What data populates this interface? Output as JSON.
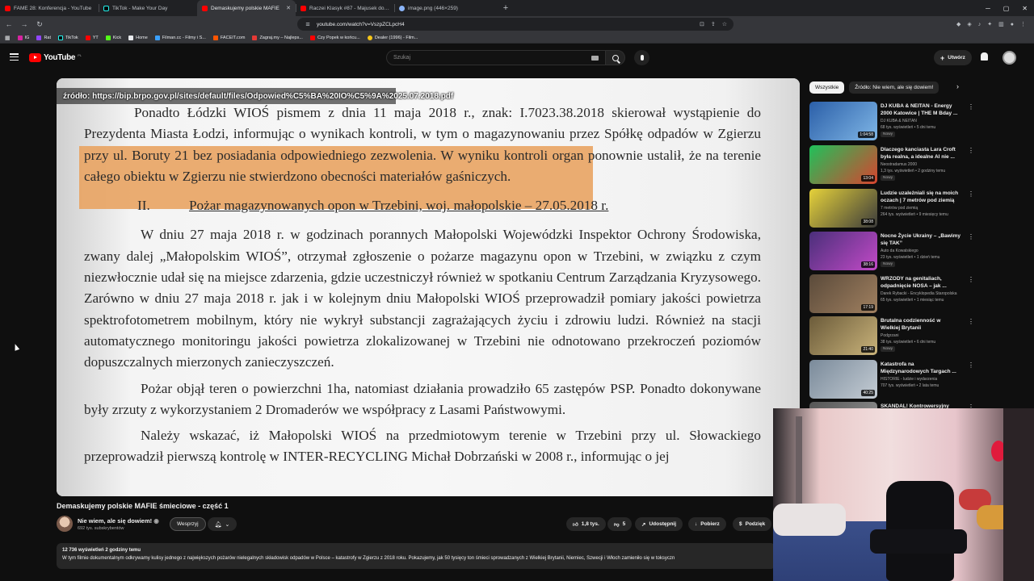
{
  "browser": {
    "tabs": [
      {
        "title": "FAME 28: Konferencja - YouTube",
        "icon": "youtube-favicon",
        "active": false
      },
      {
        "title": "TikTok - Make Your Day",
        "icon": "tiktok-favicon",
        "active": false
      },
      {
        "title": "Demaskujemy polskie MAFIE",
        "icon": "youtube-favicon",
        "active": true
      },
      {
        "title": "Raczei Klasyk #87 - Majusek dostaje",
        "icon": "youtube-favicon",
        "active": false
      },
      {
        "title": "image.png (446×259)",
        "icon": "globe-favicon",
        "active": false
      }
    ],
    "url": "youtube.com/watch?v=VszpZCLpcH4",
    "bookmarks": [
      "IG",
      "Rat",
      "TikTok",
      "YT",
      "Kick",
      "Home",
      "Filman.cc - Filmy i S...",
      "FACEIT.com",
      "Zagraj.my – Najleps...",
      "Czy Popek w końcu...",
      "Dealer (1996) - Film..."
    ]
  },
  "header": {
    "logo_text": "YouTube",
    "country": "PL",
    "search_placeholder": "Szukaj",
    "create_label": "Utwórz"
  },
  "player": {
    "source_label": "źródło: https://bip.brpo.gov.pl/sites/default/files/Odpowied%C5%BA%20IO%C5%9A%2025.07.2018.pdf",
    "paragraph1": "Ponadto Łódzki WIOŚ pismem z dnia 11 maja 2018 r., znak: I.7023.38.2018 skierował wystąpienie do Prezydenta Miasta Łodzi, informując o wynikach kontroli, w tym o magazynowaniu przez Spółkę odpadów w Zgierzu przy ul. Boruty 21 bez posiadania odpowiedniego zezwolenia. W wyniku kontroli organ ponownie ustalił, że na terenie całego obiektu w Zgierzu nie stwierdzono obecności materiałów gaśniczych.",
    "heading_num": "II.",
    "heading_text": "Pożar magazynowanych opon w Trzebini, woj. małopolskie – 27.05.2018 r.",
    "paragraph2": "W dniu 27 maja 2018 r. w godzinach porannych Małopolski Wojewódzki Inspektor Ochrony Środowiska, zwany dalej „Małopolskim WIOŚ”, otrzymał zgłoszenie o pożarze magazynu opon w Trzebini, w związku z czym niezwłocznie udał się na miejsce zdarzenia, gdzie uczestniczył również w spotkaniu Centrum Zarządzania Kryzysowego. Zarówno w dniu 27 maja 2018 r. jak i w kolejnym dniu Małopolski WIOŚ przeprowadził pomiary jakości powietrza spektrofotometrem mobilnym, który nie wykrył substancji zagrażających życiu i zdrowiu ludzi. Również na stacji automatycznego monitoringu jakości powietrza zlokalizowanej w Trzebini nie odnotowano przekroczeń poziomów dopuszczalnych mierzonych zanieczyszczeń.",
    "paragraph3": "Pożar objął teren o powierzchni 1ha, natomiast działania prowadziło 65 zastępów PSP. Ponadto dokonywane były zrzuty z wykorzystaniem 2 Dromaderów we współpracy z Lasami Państwowymi.",
    "paragraph4": "Należy wskazać, iż Małopolski WIOŚ na przedmiotowym terenie w Trzebini przy ul. Słowackiego przeprowadził pierwszą kontrolę w INTER-RECYCLING Michał Dobrzański w 2008 r., informując o jej"
  },
  "video": {
    "title": "Demaskujemy polskie MAFIE śmieciowe - część 1",
    "channel": "Nie wiem, ale się dowiem!",
    "subscribers": "692 tys. subskrybentów",
    "support_label": "Wesprzyj",
    "likes": "1,8 tys.",
    "dislikes": "5",
    "share_label": "Udostępnij",
    "download_label": "Pobierz",
    "thanks_label": "Podzięk",
    "views_time": "12 736 wyświetleń  2 godziny temu",
    "description": "W tym filmie dokumentalnym odkrywamy kulisy jednego z największych pożarów nielegalnych składowisk odpadów w Polsce – katastrofy w Zgierzu z 2018 roku. Pokazujemy, jak 50 tysięcy ton śmieci sprowadzanych z Wielkiej Brytanii, Niemiec, Szwecji i Włoch zamieniło się w toksyczn"
  },
  "sidebar": {
    "chips": [
      "Wszystkie",
      "Źródło: Nie wiem, ale się dowiem!"
    ],
    "recommendations": [
      {
        "title": "DJ KUBA & NEITAN - Energy 2000 Katowice | THE M Bday ...",
        "channel": "DJ KUBA & NEITAN",
        "meta": "68 tys. wyświetleń • 5 dni temu",
        "badge": "Nowy",
        "duration": "1:04:58",
        "color_a": "#2b5fa8",
        "color_b": "#7fb6e6"
      },
      {
        "title": "Dlaczego kanciasta Lara Croft była realna, a idealne AI nie ...",
        "channel": "Neostradamus 2000",
        "meta": "1,3 tys. wyświetleń • 2 godziny temu",
        "badge": "Nowy",
        "duration": "13:04",
        "color_a": "#1fc15a",
        "color_b": "#d7442f"
      },
      {
        "title": "Ludzie uzależniali się na moich oczach | 7 metrów pod ziemią",
        "channel": "7 metrów pod ziemią",
        "meta": "264 tys. wyświetleń • 9 miesięcy temu",
        "badge": "",
        "duration": "38:08",
        "color_a": "#e6d23a",
        "color_b": "#3b3b3b"
      },
      {
        "title": "Nocne Życie Ukrainy – „Bawimy się TAK”",
        "channel": "Auto da Kowalskiego",
        "meta": "23 tys. wyświetleń • 1 dzień temu",
        "badge": "Nowy",
        "duration": "38:16",
        "color_a": "#4a2f7a",
        "color_b": "#c24ac7"
      },
      {
        "title": "WRZODY na genitaliach, odpadnięcie NOSA – jak ...",
        "channel": "Darek Rybacki - Encyklopedia Staropolska",
        "meta": "65 tys. wyświetleń • 1 miesiąc temu",
        "badge": "",
        "duration": "17:19",
        "color_a": "#5a4a3a",
        "color_b": "#a08060"
      },
      {
        "title": "Brutalna codzienność w Wielkiej Brytanii",
        "channel": "Podgrzani",
        "meta": "38 tys. wyświetleń • 6 dni temu",
        "badge": "Nowy",
        "duration": "21:40",
        "color_a": "#6b5b3a",
        "color_b": "#c9b37a"
      },
      {
        "title": "Katastrofa na Międzynarodowych Targach ...",
        "channel": "HISTORIE - ludzie i wydarzenia",
        "meta": "707 tys. wyświetleń • 2 lata temu",
        "badge": "",
        "duration": "40:25",
        "color_a": "#7a8a9a",
        "color_b": "#c4ccd4"
      },
      {
        "title": "SKANDAL! Kontrowersyjny",
        "channel": "",
        "meta": "",
        "badge": "",
        "duration": "",
        "color_a": "#555",
        "color_b": "#999"
      }
    ]
  },
  "colors": {
    "highlight": "#e8a565",
    "accent": "#ff0000",
    "background": "#0f0f0f"
  }
}
